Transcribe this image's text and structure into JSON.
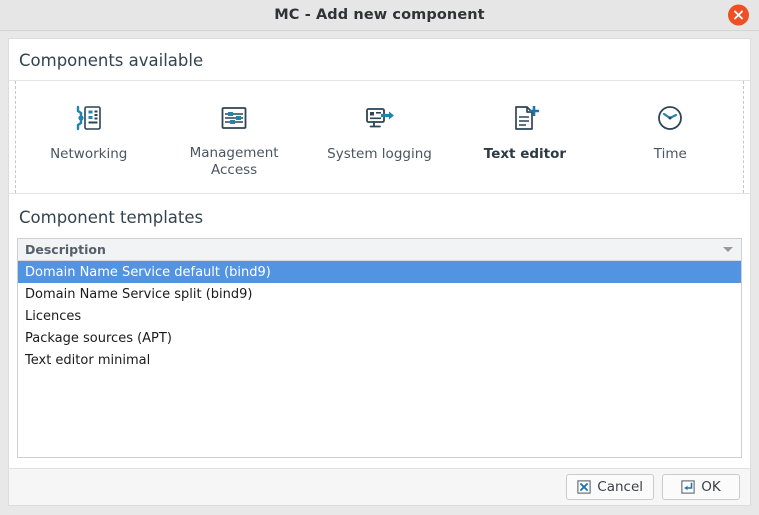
{
  "window": {
    "title": "MC - Add new component",
    "close_icon": "close-icon",
    "close_color": "#ee4f23"
  },
  "components_section": {
    "heading": "Components available",
    "items": [
      {
        "label": "Networking",
        "icon": "network-device-config-icon",
        "selected": false
      },
      {
        "label": "Management\nAccess",
        "icon": "sliders-panel-icon",
        "selected": false
      },
      {
        "label": "System logging",
        "icon": "monitor-arrow-out-icon",
        "selected": false
      },
      {
        "label": "Text editor",
        "icon": "document-plus-icon",
        "selected": true
      },
      {
        "label": "Time",
        "icon": "clock-icon",
        "selected": false
      }
    ]
  },
  "templates_section": {
    "heading": "Component templates",
    "column_header": "Description",
    "sort_icon": "sort-descending-triangle-icon",
    "selected_row_color": "#5294e2",
    "rows": [
      {
        "description": "Domain Name Service default (bind9)",
        "selected": true
      },
      {
        "description": "Domain Name Service split (bind9)",
        "selected": false
      },
      {
        "description": "Licences",
        "selected": false
      },
      {
        "description": "Package sources (APT)",
        "selected": false
      },
      {
        "description": "Text editor minimal",
        "selected": false
      }
    ]
  },
  "actions": {
    "cancel_label": "Cancel",
    "cancel_icon": "cancel-x-box-icon",
    "ok_label": "OK",
    "ok_icon": "enter-return-box-icon"
  }
}
